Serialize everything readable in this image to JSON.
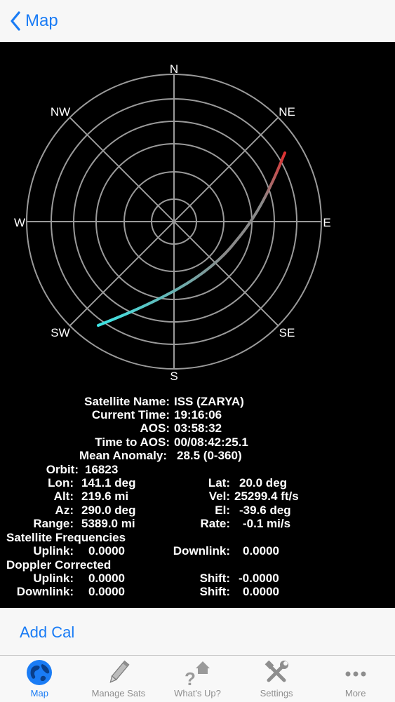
{
  "nav": {
    "back_label": "Map"
  },
  "radar": {
    "directions": {
      "n": "N",
      "ne": "NE",
      "e": "E",
      "se": "SE",
      "s": "S",
      "sw": "SW",
      "w": "W",
      "nw": "NW"
    },
    "track_colors": {
      "start": "#3ee6e6",
      "mid": "#8a8a8a",
      "end": "#e03030"
    }
  },
  "info": {
    "satellite_name_label": "Satellite Name:",
    "satellite_name": "ISS (ZARYA)",
    "current_time_label": "Current Time:",
    "current_time": "19:16:06",
    "aos_label": "AOS:",
    "aos": "03:58:32",
    "time_to_aos_label": "Time to AOS:",
    "time_to_aos": "00/08:42:25.1",
    "mean_anomaly_label": "Mean Anomaly:",
    "mean_anomaly": "28.5 (0-360)",
    "orbit_label": "Orbit:",
    "orbit": "16823",
    "lon_label": "Lon:",
    "lon": "141.1 deg",
    "lat_label": "Lat:",
    "lat": "20.0 deg",
    "alt_label": "Alt:",
    "alt": "219.6 mi",
    "vel_label": "Vel:",
    "vel": "25299.4 ft/s",
    "az_label": "Az:",
    "az": "290.0 deg",
    "el_label": "El:",
    "el": "-39.6 deg",
    "range_label": "Range:",
    "range": "5389.0 mi",
    "rate_label": "Rate:",
    "rate": "-0.1 mi/s",
    "sat_freq_heading": "Satellite Frequencies",
    "uplink_label": "Uplink:",
    "uplink": "0.0000",
    "downlink_label": "Downlink:",
    "downlink": "0.0000",
    "doppler_heading": "Doppler Corrected",
    "dc_uplink_label": "Uplink:",
    "dc_uplink": "0.0000",
    "dc_shift1_label": "Shift:",
    "dc_shift1": "-0.0000",
    "dc_downlink_label": "Downlink:",
    "dc_downlink": "0.0000",
    "dc_shift2_label": "Shift:",
    "dc_shift2": "0.0000"
  },
  "add_cal_label": "Add Cal",
  "tabs": [
    {
      "label": "Map",
      "icon": "globe-icon",
      "active": true
    },
    {
      "label": "Manage Sats",
      "icon": "pencil-icon",
      "active": false
    },
    {
      "label": "What's Up?",
      "icon": "question-house-icon",
      "active": false
    },
    {
      "label": "Settings",
      "icon": "tools-icon",
      "active": false
    },
    {
      "label": "More",
      "icon": "more-dots-icon",
      "active": false
    }
  ],
  "colors": {
    "accent": "#1a7cf5",
    "inactive": "#8e8e8e"
  }
}
